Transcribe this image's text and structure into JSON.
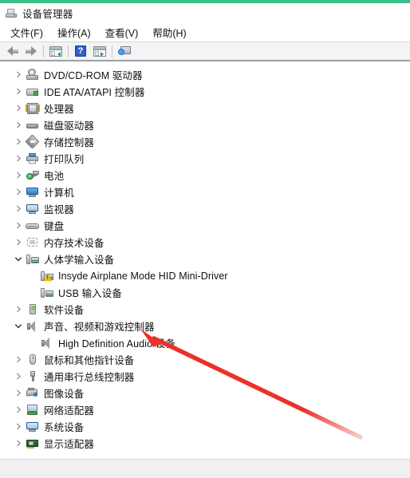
{
  "window": {
    "title": "设备管理器",
    "title_icon": "computer-icon",
    "accent_color": "#3cc08a"
  },
  "menubar": {
    "items": [
      {
        "label": "文件(F)"
      },
      {
        "label": "操作(A)"
      },
      {
        "label": "查看(V)"
      },
      {
        "label": "帮助(H)"
      }
    ]
  },
  "toolbar": {
    "buttons": [
      {
        "name": "back",
        "icon": "arrow-left-icon"
      },
      {
        "name": "forward",
        "icon": "arrow-right-icon"
      },
      {
        "name": "properties",
        "icon": "properties-window-icon"
      },
      {
        "name": "help",
        "icon": "help-question-icon"
      },
      {
        "name": "update-driver",
        "icon": "update-window-icon"
      },
      {
        "name": "scan-hardware-changes",
        "icon": "scan-computer-icon"
      }
    ]
  },
  "tree": {
    "nodes": [
      {
        "label": "DVD/CD-ROM 驱动器",
        "icon": "dvd-drive-icon",
        "level": 1,
        "state": "collapsed",
        "warning": false
      },
      {
        "label": "IDE ATA/ATAPI 控制器",
        "icon": "ide-controller-icon",
        "level": 1,
        "state": "collapsed",
        "warning": false
      },
      {
        "label": "处理器",
        "icon": "processor-icon",
        "level": 1,
        "state": "collapsed",
        "warning": false
      },
      {
        "label": "磁盘驱动器",
        "icon": "disk-drive-icon",
        "level": 1,
        "state": "collapsed",
        "warning": false
      },
      {
        "label": "存储控制器",
        "icon": "storage-controller-icon",
        "level": 1,
        "state": "collapsed",
        "warning": false
      },
      {
        "label": "打印队列",
        "icon": "print-queue-icon",
        "level": 1,
        "state": "collapsed",
        "warning": false
      },
      {
        "label": "电池",
        "icon": "battery-icon",
        "level": 1,
        "state": "collapsed",
        "warning": false
      },
      {
        "label": "计算机",
        "icon": "computer-icon",
        "level": 1,
        "state": "collapsed",
        "warning": false
      },
      {
        "label": "监视器",
        "icon": "monitor-icon",
        "level": 1,
        "state": "collapsed",
        "warning": false
      },
      {
        "label": "键盘",
        "icon": "keyboard-icon",
        "level": 1,
        "state": "collapsed",
        "warning": false
      },
      {
        "label": "内存技术设备",
        "icon": "memory-device-icon",
        "level": 1,
        "state": "collapsed",
        "warning": false
      },
      {
        "label": "人体学输入设备",
        "icon": "hid-icon",
        "level": 1,
        "state": "expanded",
        "warning": false
      },
      {
        "label": "Insyde Airplane Mode HID Mini-Driver",
        "icon": "hid-icon",
        "level": 2,
        "state": "leaf",
        "warning": true
      },
      {
        "label": "USB 输入设备",
        "icon": "hid-icon",
        "level": 2,
        "state": "leaf",
        "warning": false
      },
      {
        "label": "软件设备",
        "icon": "software-device-icon",
        "level": 1,
        "state": "collapsed",
        "warning": false
      },
      {
        "label": "声音、视频和游戏控制器",
        "icon": "speaker-icon",
        "level": 1,
        "state": "expanded",
        "warning": false
      },
      {
        "label": "High Definition Audio 设备",
        "icon": "speaker-icon",
        "level": 2,
        "state": "leaf",
        "warning": false
      },
      {
        "label": "鼠标和其他指针设备",
        "icon": "mouse-icon",
        "level": 1,
        "state": "collapsed",
        "warning": false
      },
      {
        "label": "通用串行总线控制器",
        "icon": "usb-controller-icon",
        "level": 1,
        "state": "collapsed",
        "warning": false
      },
      {
        "label": "图像设备",
        "icon": "imaging-device-icon",
        "level": 1,
        "state": "collapsed",
        "warning": false
      },
      {
        "label": "网络适配器",
        "icon": "network-adapter-icon",
        "level": 1,
        "state": "collapsed",
        "warning": false
      },
      {
        "label": "系统设备",
        "icon": "system-device-icon",
        "level": 1,
        "state": "collapsed",
        "warning": false
      },
      {
        "label": "显示适配器",
        "icon": "display-adapter-icon",
        "level": 1,
        "state": "collapsed",
        "warning": false
      }
    ]
  },
  "annotation": {
    "type": "arrow",
    "color": "#e8322a",
    "points_to": "声音、视频和游戏控制器"
  },
  "statusbar": {
    "text": ""
  }
}
